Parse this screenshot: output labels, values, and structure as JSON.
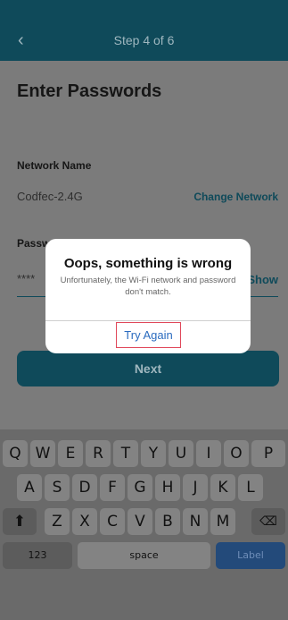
{
  "header": {
    "back_icon": "chevron-left-icon",
    "title": "Step 4 of 6"
  },
  "main": {
    "page_title": "Enter Passwords",
    "network_label": "Network Name",
    "network_value": "Codfec-2.4G",
    "change_network": "Change Network",
    "password_label": "Passw",
    "password_value": "****",
    "show_label": "Show",
    "next_button": "Next"
  },
  "dialog": {
    "title": "Oops, something is wrong",
    "message": "Unfortunately, the Wi-Fi network and password don't match.",
    "button": "Try Again"
  },
  "keyboard": {
    "row1": [
      "Q",
      "W",
      "E",
      "R",
      "T",
      "Y",
      "U",
      "I",
      "O",
      "P"
    ],
    "row2": [
      "A",
      "S",
      "D",
      "F",
      "G",
      "H",
      "J",
      "K",
      "L"
    ],
    "row3": [
      "Z",
      "X",
      "C",
      "V",
      "B",
      "N",
      "M"
    ],
    "shift_icon": "shift-icon",
    "backspace_icon": "backspace-icon",
    "numbers": "123",
    "space": "space",
    "action": "Label"
  },
  "colors": {
    "primary": "#0f4a5a",
    "link_blue": "#2a6bbf",
    "highlight_red": "#e0485a"
  }
}
